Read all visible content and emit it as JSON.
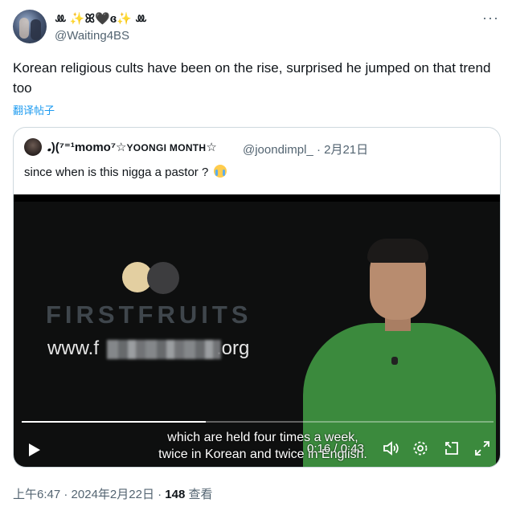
{
  "tweet": {
    "display_name": "ꔛ ✨ꕤ🖤ɞ✨ ꔛ",
    "handle": "@Waiting4BS",
    "more_label": "···",
    "text": "Korean religious cults have been on the rise, surprised he jumped on that trend too",
    "translate_label": "翻译帖子",
    "time": "上午6:47",
    "date": "2024年2月22日",
    "separator": "·",
    "views_count": "148",
    "views_label": "查看"
  },
  "quote": {
    "name_prefix": "𝅘)(⁷⁼¹momo⁷☆",
    "name_smallcaps": "YOONGI MONTH",
    "name_suffix": "☆",
    "handle": "@joondimpl_",
    "separator": "·",
    "date": "2月21日",
    "text": "since when is this nigga a pastor ?",
    "emoji": "loudly-crying-face"
  },
  "video": {
    "brand": "FIRSTFRUITS",
    "url_prefix": "www.f",
    "url_suffix": ".org",
    "subtitle_line1": "which are held four times a week,",
    "subtitle_line2": "twice in Korean and twice in English.",
    "time_display": "0:16 / 0:43",
    "progress": 0.39,
    "colors": {
      "brand_gold": "#e3cfa1",
      "shirt_green": "#3b8a3d"
    }
  },
  "colors": {
    "link": "#1d9bf0",
    "secondary": "#536471",
    "border": "#cfd9de"
  }
}
